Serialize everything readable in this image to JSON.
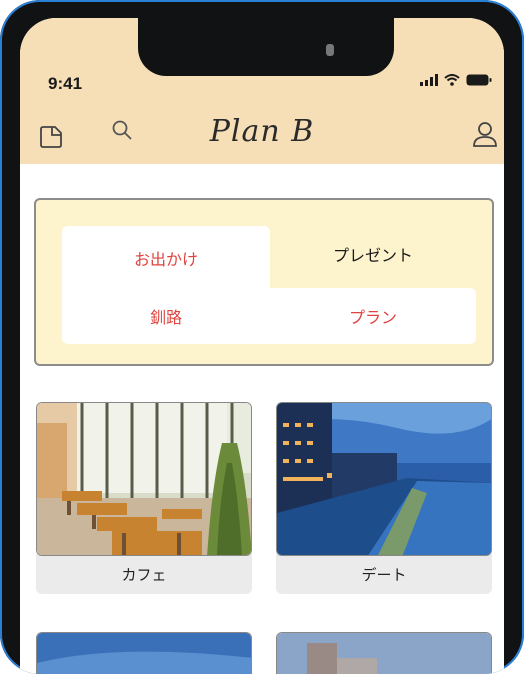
{
  "status_bar": {
    "time": "9:41"
  },
  "header": {
    "logo_text": "Plan B"
  },
  "filter_panel": {
    "tabs": [
      {
        "label": "お出かけ",
        "selected": true
      },
      {
        "label": "プレゼント",
        "selected": false
      }
    ],
    "location_label": "釧路",
    "plan_label": "プラン"
  },
  "cards": [
    {
      "label": "カフェ",
      "image": "cafe-interior-photo"
    },
    {
      "label": "デート",
      "image": "night-riverside-city-photo"
    },
    {
      "label": "",
      "image": "blue-sky-photo"
    },
    {
      "label": "",
      "image": "building-sky-photo"
    }
  ],
  "colors": {
    "header_bg": "#f6dfb6",
    "panel_bg": "#fdf3cd",
    "accent_red": "#e0433f",
    "card_label_bg": "#ebebeb"
  }
}
